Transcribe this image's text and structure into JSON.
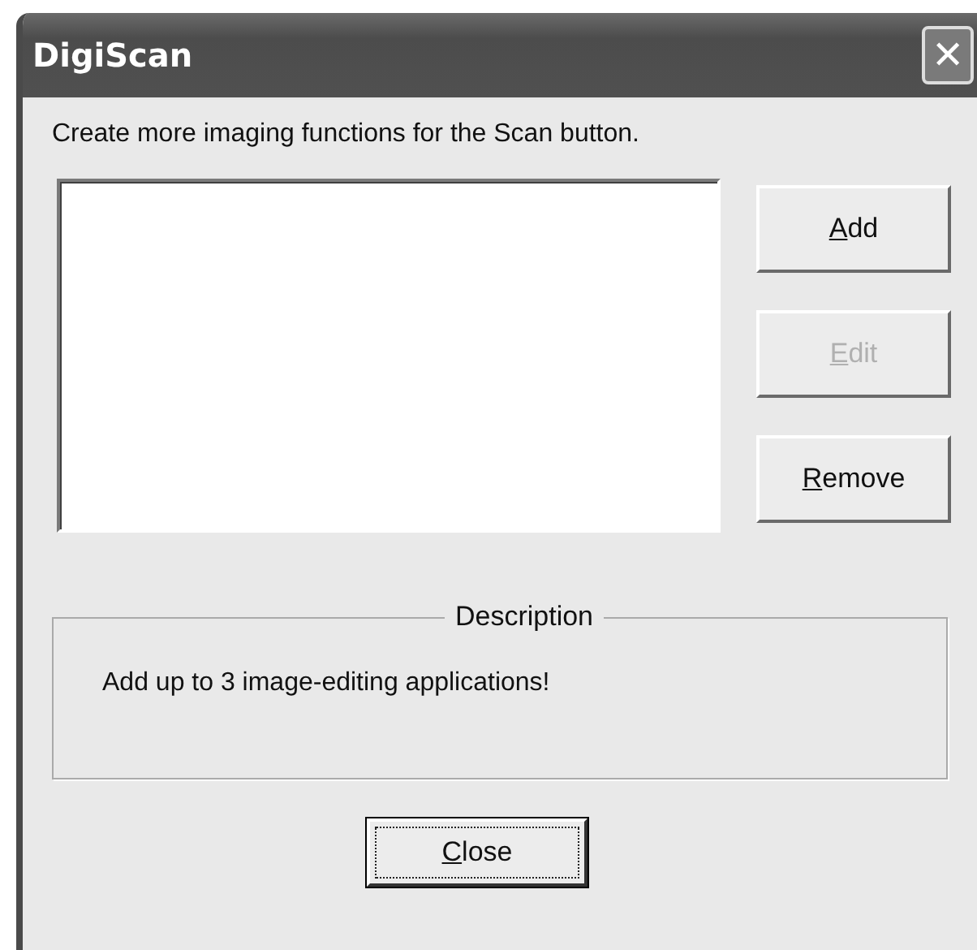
{
  "window": {
    "title": "DigiScan",
    "close_glyph": "✕"
  },
  "instruction": "Create more imaging functions for the Scan button.",
  "buttons": [
    {
      "label": "Add",
      "disabled": false
    },
    {
      "label": "Edit",
      "disabled": true
    },
    {
      "label": "Remove",
      "disabled": false
    }
  ],
  "description": {
    "legend": "Description",
    "text": "Add up to 3 image-editing applications!"
  },
  "footer_button": {
    "label": "Close",
    "default": true
  }
}
